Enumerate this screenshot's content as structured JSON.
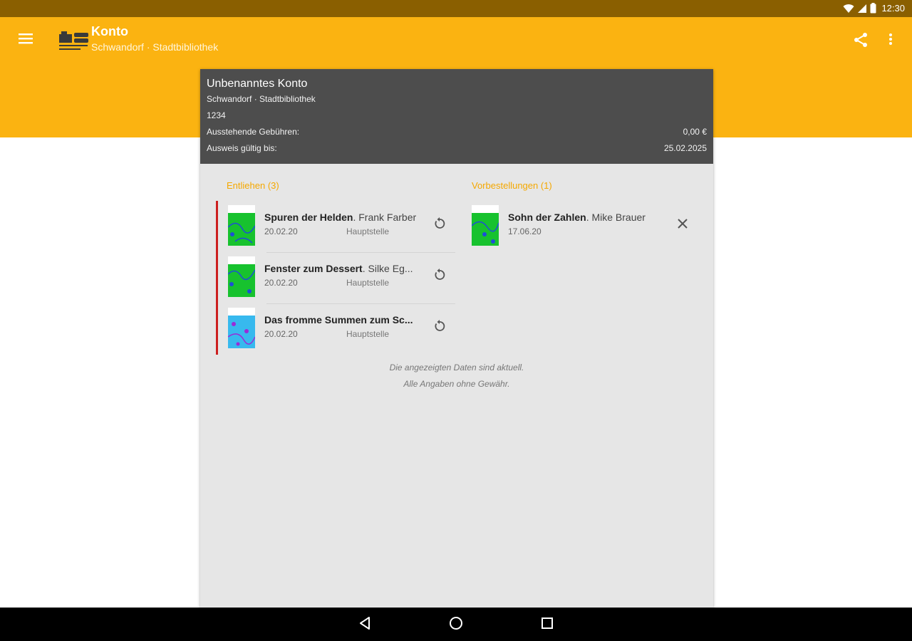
{
  "status_bar": {
    "time": "12:30",
    "icons": [
      "wifi-icon",
      "signal-icon",
      "battery-icon"
    ]
  },
  "app_bar": {
    "title": "Konto",
    "subtitle": "Schwandorf · Stadtbibliothek",
    "icons": [
      "menu-icon",
      "library-logo",
      "share-icon",
      "more-vert-icon"
    ],
    "color": "#fbb311"
  },
  "account": {
    "name": "Unbenanntes Konto",
    "library": "Schwandorf · Stadtbibliothek",
    "number": "1234",
    "fees_label": "Ausstehende Gebühren:",
    "fees_value": "0,00 €",
    "valid_label": "Ausweis gültig bis:",
    "valid_value": "25.02.2025"
  },
  "lent": {
    "title": "Entliehen (3)",
    "items": [
      {
        "title": "Spuren der Helden",
        "author": ". Frank Farber",
        "date": "20.02.20",
        "branch": "Hauptstelle",
        "action_icon": "renew-icon"
      },
      {
        "title": "Fenster zum Dessert",
        "author": ". Silke Eg...",
        "date": "20.02.20",
        "branch": "Hauptstelle",
        "action_icon": "renew-icon"
      },
      {
        "title": "Das fromme Summen zum Sc...",
        "author": "",
        "date": "20.02.20",
        "branch": "Hauptstelle",
        "action_icon": "renew-icon"
      }
    ]
  },
  "reservations": {
    "title": "Vorbestellungen (1)",
    "items": [
      {
        "title": "Sohn der Zahlen",
        "author": ". Mike Brauer",
        "date": "17.06.20",
        "action_icon": "close-icon"
      }
    ]
  },
  "footer": {
    "line1": "Die angezeigten Daten sind aktuell.",
    "line2": "Alle Angaben ohne Gewähr."
  },
  "nav_bar": {
    "icons": [
      "back-icon",
      "home-icon",
      "recents-icon"
    ]
  }
}
